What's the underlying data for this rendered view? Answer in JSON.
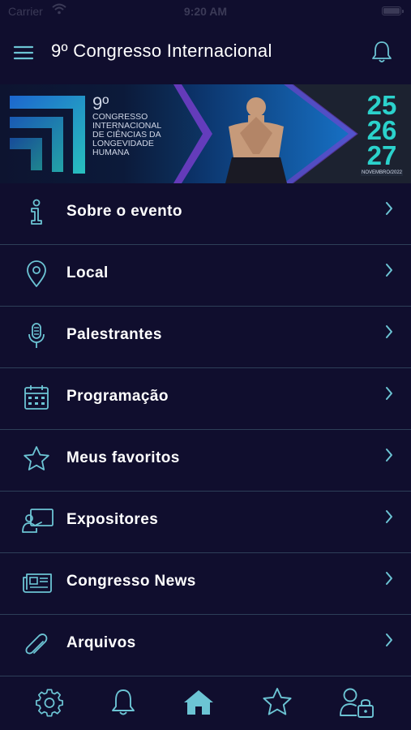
{
  "status_bar": {
    "carrier": "Carrier",
    "time": "9:20 AM"
  },
  "header": {
    "title": "9º Congresso Internacional"
  },
  "banner": {
    "number": "9º",
    "lines": [
      "Congresso",
      "Internacional",
      "de Ciências da",
      "Longevidade",
      "Humana"
    ],
    "dates": [
      "25",
      "26",
      "27"
    ],
    "month": "NOVEMBRO/2022"
  },
  "menu": {
    "items": [
      {
        "label": "Sobre o evento",
        "icon": "info-icon"
      },
      {
        "label": "Local",
        "icon": "location-pin-icon"
      },
      {
        "label": "Palestrantes",
        "icon": "microphone-icon"
      },
      {
        "label": "Programação",
        "icon": "calendar-icon"
      },
      {
        "label": "Meus favoritos",
        "icon": "star-icon"
      },
      {
        "label": "Expositores",
        "icon": "exhibitor-icon"
      },
      {
        "label": "Congresso News",
        "icon": "newspaper-icon"
      },
      {
        "label": "Arquivos",
        "icon": "paperclip-icon"
      }
    ]
  },
  "tab_bar": {
    "tabs": [
      "settings-icon",
      "bell-icon",
      "home-icon",
      "star-icon",
      "user-lock-icon"
    ],
    "active": "home-icon"
  },
  "colors": {
    "background": "#100e2e",
    "accent": "#6cc4d4",
    "divider": "#2d3f58"
  }
}
